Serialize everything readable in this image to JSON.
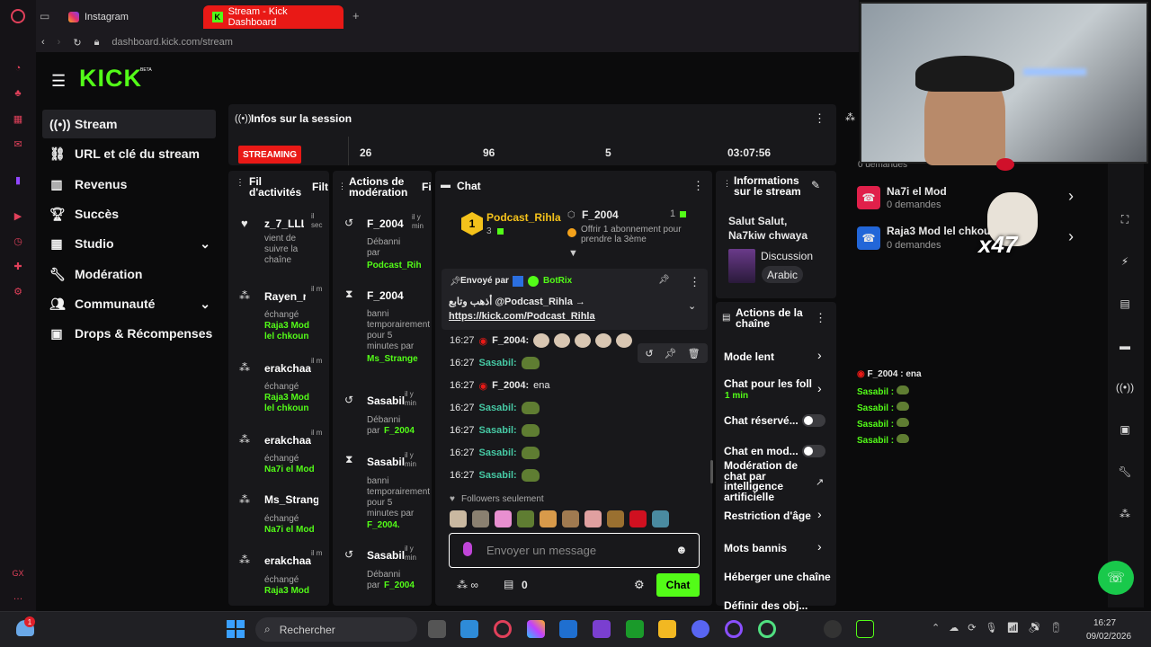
{
  "browser": {
    "tab1": "Instagram",
    "tab2": "Stream - Kick Dashboard",
    "url": "dashboard.kick.com/stream",
    "new_tab": "+"
  },
  "logo": {
    "text": "KICK",
    "beta": "BETA"
  },
  "nav": [
    {
      "label": "Stream",
      "icon": "broadcast-icon"
    },
    {
      "label": "URL et clé du stream",
      "icon": "link-icon"
    },
    {
      "label": "Revenus",
      "icon": "chart-icon"
    },
    {
      "label": "Succès",
      "icon": "trophy-icon"
    },
    {
      "label": "Studio",
      "icon": "grid-icon"
    },
    {
      "label": "Modération",
      "icon": "wrench-icon"
    },
    {
      "label": "Communauté",
      "icon": "people-icon"
    },
    {
      "label": "Drops & Récompenses",
      "icon": "gift-icon"
    }
  ],
  "session": {
    "title": "Infos sur la session",
    "status": "STREAMING",
    "stat1": "26",
    "stat2": "96",
    "stat3": "5",
    "duration": "03:07:56"
  },
  "activity": {
    "title1": "Fil",
    "title2": "d'activités",
    "tab": "Filt",
    "items": [
      {
        "name": "z_7_LLL",
        "time": "il sec",
        "sub": "vient de suivre la chaîne",
        "reward": ""
      },
      {
        "name": "Rayen_r",
        "time": "il m",
        "sub": "échangé",
        "reward": "Raja3 Mod lel chkoun"
      },
      {
        "name": "erakchaa",
        "time": "il m",
        "sub": "échangé",
        "reward": "Raja3 Mod lel chkoun"
      },
      {
        "name": "erakchaa",
        "time": "il m",
        "sub": "échangé",
        "reward": "Na7i el Mod"
      },
      {
        "name": "Ms_Strang",
        "time": "il m",
        "sub": "échangé",
        "reward": "Na7i el Mod"
      },
      {
        "name": "erakchaa",
        "time": "il m",
        "sub": "échangé",
        "reward": "Raja3 Mod"
      }
    ]
  },
  "modactions": {
    "title1": "Actions de",
    "title2": "modération",
    "tab": "Fil",
    "items": [
      {
        "name": "F_2004",
        "time": "il y min",
        "sub": "Débanni par",
        "by": "Podcast_Rih"
      },
      {
        "name": "F_2004",
        "time": "il y min",
        "sub": "banni temporairement pour 5 minutes par",
        "by": "Ms_Strange"
      },
      {
        "name": "Sasabil",
        "time": "il y min",
        "sub": "Débanni par",
        "by": "F_2004"
      },
      {
        "name": "Sasabil",
        "time": "il y min",
        "sub": "banni temporairement pour 5 minutes par",
        "by": "F_2004."
      },
      {
        "name": "Sasabil",
        "time": "il y min",
        "sub": "Débanni par",
        "by": "F_2004"
      }
    ]
  },
  "chat": {
    "title": "Chat",
    "top1_rank": "1",
    "top1_name": "Podcast_Rihla",
    "top1_count": "3",
    "top2_name": "F_2004",
    "top2_count": "1",
    "top2_sub": "Offrir 1 abonnement pour prendre la 3ème",
    "pinned_by": "Envoyé par",
    "pinned_bot": "BotRix",
    "pinned_text": "أذهب وتابع @Podcast_Rihla →",
    "pinned_link": "https://kick.com/Podcast_Rihla",
    "messages": [
      {
        "time": "16:27",
        "user": "F_2004:",
        "text": "",
        "kind": "dogs"
      },
      {
        "time": "16:27",
        "user": "Sasabil:",
        "text": "",
        "kind": "frog"
      },
      {
        "time": "16:27",
        "user": "F_2004:",
        "text": "ena",
        "kind": "text"
      },
      {
        "time": "16:27",
        "user": "Sasabil:",
        "text": "",
        "kind": "frog"
      },
      {
        "time": "16:27",
        "user": "Sasabil:",
        "text": "",
        "kind": "frog"
      },
      {
        "time": "16:27",
        "user": "Sasabil:",
        "text": "",
        "kind": "frog"
      },
      {
        "time": "16:27",
        "user": "Sasabil:",
        "text": "",
        "kind": "frog"
      }
    ],
    "followers_only": "Followers seulement",
    "input_placeholder": "Envoyer un message",
    "points": "0",
    "send": "Chat"
  },
  "streaminfo": {
    "title1": "Informations",
    "title2": "sur le stream",
    "stream_title": "Salut Salut, Na7kiw chwaya",
    "category": "Discussion",
    "language": "Arabic"
  },
  "channel": {
    "title1": "Actions de la",
    "title2": "chaîne",
    "slow": "Mode lent",
    "followers": "Chat pour les foll",
    "followers_sub": "1 min",
    "reserved": "Chat réservé...",
    "modchat": "Chat en mod...",
    "ai1": "Modération de",
    "ai2": "chat par",
    "ai3": "intelligence",
    "ai4": "artificielle",
    "age": "Restriction d'âge",
    "banned": "Mots bannis",
    "host": "Héberger une chaîne",
    "define": "Définir des obj..."
  },
  "rewards": {
    "header": "0 demandes",
    "items": [
      {
        "name": "Na7i el Mod",
        "sub": "0 demandes"
      },
      {
        "name": "Raja3 Mod lel chkoun",
        "sub": "0 demandes"
      }
    ]
  },
  "overlay": {
    "multiplier": "x47",
    "chat": [
      {
        "user": "F_2004 :",
        "text": "ena"
      },
      {
        "user": "Sasabil :",
        "text": ""
      },
      {
        "user": "Sasabil :",
        "text": ""
      },
      {
        "user": "Sasabil :",
        "text": ""
      },
      {
        "user": "Sasabil :",
        "text": ""
      }
    ]
  },
  "taskbar": {
    "search": "Rechercher",
    "time": "16:27",
    "date": "09/02/2026",
    "badge": "1"
  },
  "colors": {
    "kick_green": "#53fc18",
    "streaming_red": "#e91916"
  }
}
